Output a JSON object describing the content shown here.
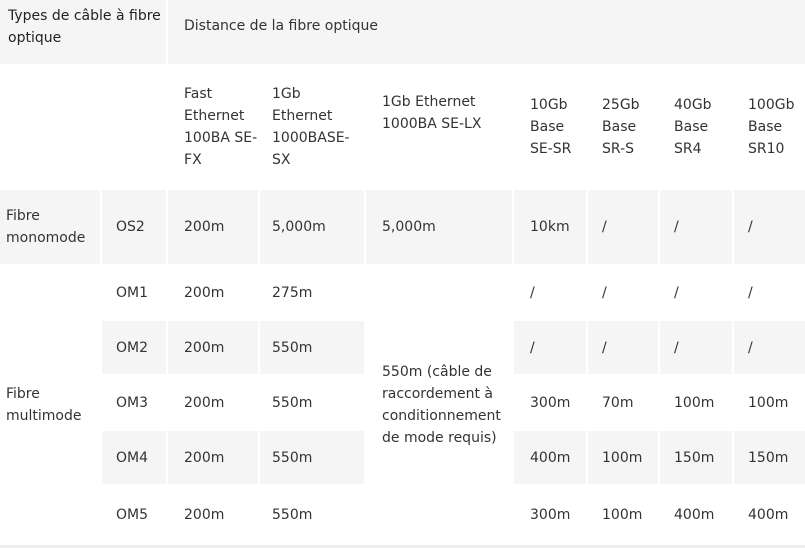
{
  "table": {
    "header": {
      "type_label": "Types de câble à fibre optique",
      "distance_label": "Distance de la fibre optique"
    },
    "columns": [
      "Fast Ethernet 100BA SE-FX",
      "1Gb Ethernet 1000BASE-SX",
      "1Gb Ethernet 1000BA SE-LX",
      "10Gb Base SE-SR",
      "25Gb Base SR-S",
      "40Gb Base SR4",
      "100Gb Base SR10"
    ],
    "groups": {
      "monomode": "Fibre monomode",
      "multimode": "Fibre multimode"
    },
    "lx_merged": "550m (câble de raccordement à conditionnement de mode requis)",
    "rows": [
      {
        "grade": "OS2",
        "fast": "200m",
        "sx": "5,000m",
        "lx": "5,000m",
        "g10": "10km",
        "g25": "/",
        "g40": "/",
        "g100": "/"
      },
      {
        "grade": "OM1",
        "fast": "200m",
        "sx": "275m",
        "g10": "/",
        "g25": "/",
        "g40": "/",
        "g100": "/"
      },
      {
        "grade": "OM2",
        "fast": "200m",
        "sx": "550m",
        "g10": "/",
        "g25": "/",
        "g40": "/",
        "g100": "/"
      },
      {
        "grade": "OM3",
        "fast": "200m",
        "sx": "550m",
        "g10": "300m",
        "g25": "70m",
        "g40": "100m",
        "g100": "100m"
      },
      {
        "grade": "OM4",
        "fast": "200m",
        "sx": "550m",
        "g10": "400m",
        "g25": "100m",
        "g40": "150m",
        "g100": "150m"
      },
      {
        "grade": "OM5",
        "fast": "200m",
        "sx": "550m",
        "g10": "300m",
        "g25": "100m",
        "g40": "400m",
        "g100": "400m"
      }
    ]
  },
  "colors": {
    "shade": "#f5f5f5",
    "text": "#333333",
    "background": "#ffffff"
  }
}
